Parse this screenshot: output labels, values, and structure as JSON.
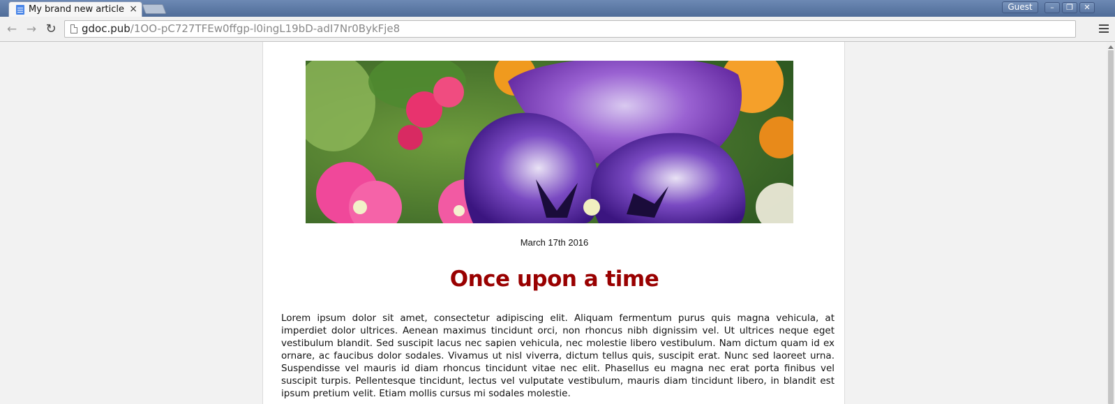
{
  "browser": {
    "tab_title": "My brand new article",
    "tab_close": "×",
    "guest_label": "Guest",
    "url_host": "gdoc.pub",
    "url_path": "/1OO-pC727TFEw0ffgp-l0ingL19bD-adI7Nr0BykFje8"
  },
  "article": {
    "date": "March 17th 2016",
    "title": "Once upon a time",
    "body": "Lorem ipsum dolor sit amet, consectetur adipiscing elit. Aliquam fermentum purus quis magna vehicula, at imperdiet dolor ultrices. Aenean maximus tincidunt orci, non rhoncus nibh dignissim vel. Ut ultrices neque eget vestibulum blandit. Sed suscipit lacus nec sapien vehicula, nec molestie libero vestibulum. Nam dictum quam id ex ornare, ac faucibus dolor sodales. Vivamus ut nisl viverra, dictum tellus quis, suscipit erat. Nunc sed laoreet urna. Suspendisse vel mauris id diam rhoncus tincidunt vitae nec elit. Phasellus eu magna nec erat porta finibus vel suscipit turpis. Pellentesque tincidunt, lectus vel vulputate vestibulum, mauris diam tincidunt libero, in blandit est ipsum pretium velit. Etiam mollis cursus mi sodales molestie."
  },
  "colors": {
    "title": "#990000",
    "titlebar": "#5b77a3"
  }
}
